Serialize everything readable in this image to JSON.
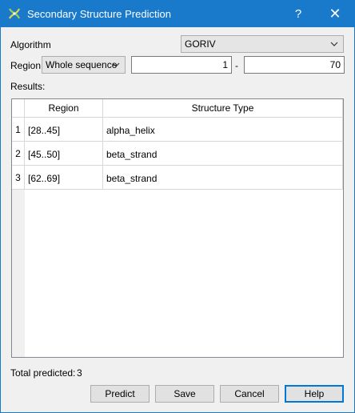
{
  "window": {
    "title": "Secondary Structure Prediction",
    "help_glyph": "?",
    "close_glyph": "✕"
  },
  "algorithm": {
    "label": "Algorithm",
    "value": "GORIV"
  },
  "region": {
    "label": "Region",
    "mode": "Whole sequence",
    "from": "1",
    "separator": "-",
    "to": "70"
  },
  "results": {
    "label": "Results:",
    "columns": [
      "Region",
      "Structure Type"
    ],
    "rows": [
      {
        "num": "1",
        "region": "[28..45]",
        "type": "alpha_helix"
      },
      {
        "num": "2",
        "region": "[45..50]",
        "type": "beta_strand"
      },
      {
        "num": "3",
        "region": "[62..69]",
        "type": "beta_strand"
      }
    ]
  },
  "total": {
    "label": "Total predicted:",
    "value": "3"
  },
  "buttons": {
    "predict": "Predict",
    "save": "Save",
    "cancel": "Cancel",
    "help": "Help"
  },
  "colors": {
    "titlebar": "#1979ca",
    "default_button_border": "#0078d7"
  }
}
